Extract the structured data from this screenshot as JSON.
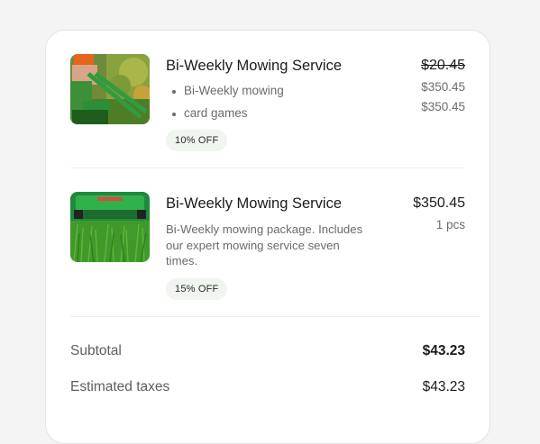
{
  "items": [
    {
      "title": "Bi-Weekly Mowing Service",
      "features": [
        "Bi-Weekly mowing",
        "card games"
      ],
      "badge": "10% OFF",
      "price_original": "$20.45",
      "price_lines": [
        "$350.45",
        "$350.45"
      ],
      "image_icon": "lawn-mower-worker-photo"
    },
    {
      "title": "Bi-Weekly Mowing Service",
      "description": "Bi-Weekly mowing package. Includes our expert mowing service seven times.",
      "badge": "15% OFF",
      "price": "$350.45",
      "quantity": "1 pcs",
      "image_icon": "mower-on-grass-photo"
    }
  ],
  "summary": {
    "subtotal_label": "Subtotal",
    "subtotal_value": "$43.23",
    "taxes_label": "Estimated taxes",
    "taxes_value": "$43.23"
  },
  "colors": {
    "background": "#f4f4f4",
    "card": "#ffffff",
    "badge_bg": "#f0f5f0",
    "muted_text": "#6b6b6b",
    "grass_green": "#3f9a2a",
    "mower_green": "#2ea84a"
  }
}
